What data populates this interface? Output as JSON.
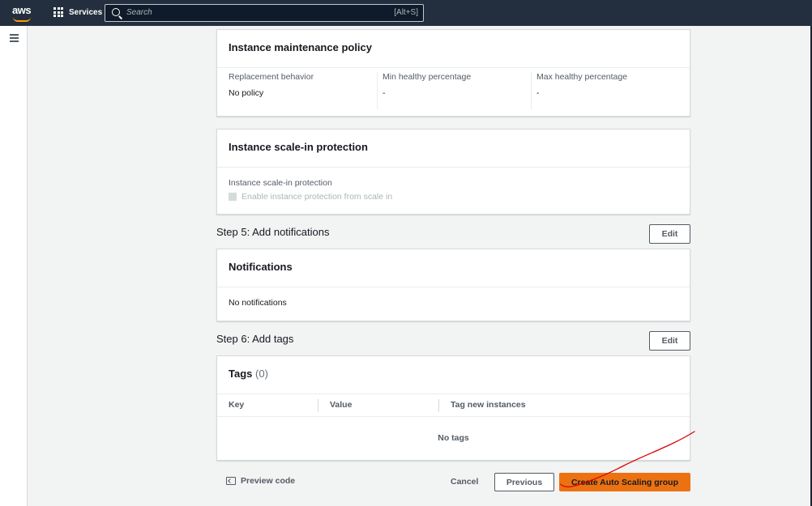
{
  "topnav": {
    "logo": "aws",
    "services": "Services",
    "search_placeholder": "Search",
    "search_shortcut": "[Alt+S]"
  },
  "maintenance": {
    "title": "Instance maintenance policy",
    "replacement_label": "Replacement behavior",
    "replacement_value": "No policy",
    "min_label": "Min healthy percentage",
    "min_value": "-",
    "max_label": "Max healthy percentage",
    "max_value": "-"
  },
  "scalein": {
    "title": "Instance scale-in protection",
    "field_label": "Instance scale-in protection",
    "checkbox_label": "Enable instance protection from scale in"
  },
  "step5": {
    "title": "Step 5: Add notifications",
    "edit": "Edit",
    "panel_title": "Notifications",
    "value": "No notifications"
  },
  "step6": {
    "title": "Step 6: Add tags",
    "edit": "Edit",
    "panel_title": "Tags",
    "count": "(0)",
    "columns": [
      "Key",
      "Value",
      "Tag new instances"
    ],
    "empty": "No tags"
  },
  "footer": {
    "preview": "Preview code",
    "cancel": "Cancel",
    "previous": "Previous",
    "create": "Create Auto Scaling group"
  },
  "colors": {
    "nav_bg": "#232f3e",
    "primary_button": "#ec7211",
    "annotation_stroke": "#e00000"
  }
}
